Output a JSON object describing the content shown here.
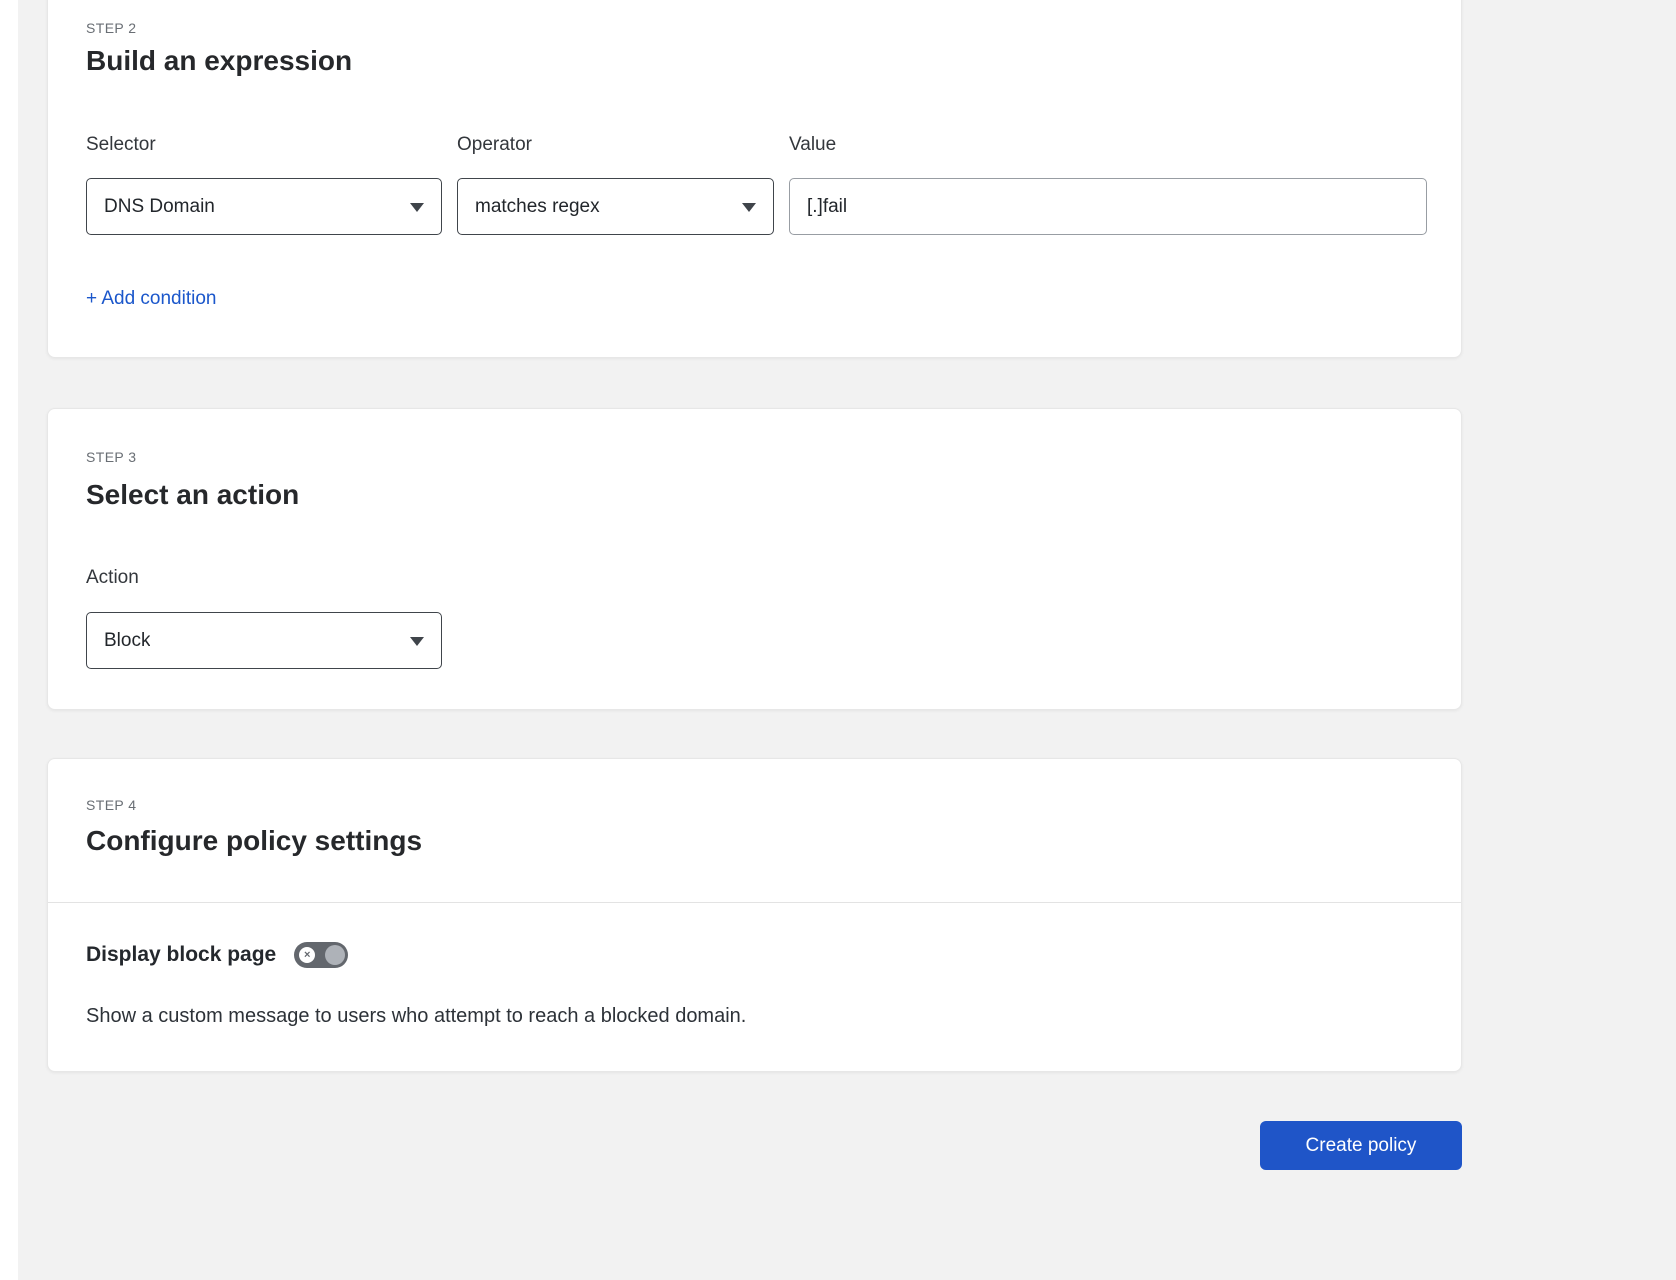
{
  "colors": {
    "background": "#f2f2f2",
    "accent_blue": "#1b57cb",
    "button_blue": "#1f55c8",
    "toggle_off_gray": "#63676d"
  },
  "step2": {
    "step_label": "STEP 2",
    "title": "Build an expression",
    "selector_label": "Selector",
    "selector_value": "DNS Domain",
    "operator_label": "Operator",
    "operator_value": "matches regex",
    "value_label": "Value",
    "value_text": "[.]fail",
    "add_condition": "+ Add condition"
  },
  "step3": {
    "step_label": "STEP 3",
    "title": "Select an action",
    "action_label": "Action",
    "action_value": "Block"
  },
  "step4": {
    "step_label": "STEP 4",
    "title": "Configure policy settings",
    "toggle_label": "Display block page",
    "toggle_state": "off",
    "toggle_icon": "×",
    "description": "Show a custom message to users who attempt to reach a blocked domain."
  },
  "footer": {
    "create_button": "Create policy"
  }
}
